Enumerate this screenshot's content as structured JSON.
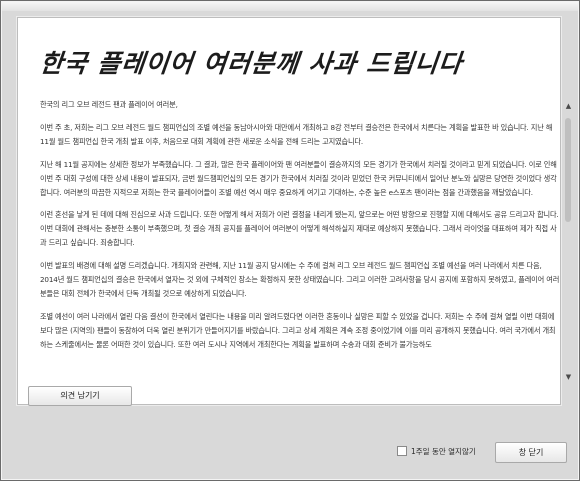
{
  "dialog": {
    "title": "한국 플레이어 여러분께 사과 드립니다",
    "greeting": "한국의 리그 오브 레전드 팬과 플레이어 여러분,",
    "paragraphs": [
      "이번 주 초, 저희는 리그 오브 레전드 월드 챔피언십의 조별 예선을 동남아시아와 대만에서 개최하고 8강 전부터 결승전은 한국에서 치른다는 계획을 발표한 바 있습니다. 지난 해 11월 월드 챔피언십 한국 개최 발표 이후, 처음으로 대회 계획에 관한 새로운 소식을 전해 드리는 고지였습니다.",
      "지난 해 11월 공지에는 상세한 정보가 부족했습니다. 그 결과, 많은 한국 플레이어와 팬 여러분들이 결승까지의 모든 경기가 한국에서 치러질 것이라고 믿게 되었습니다. 이로 인해 이번 주 대회 구성에 대한 상세 내용이 발표되자, 금번 월드챔피언십의 모든 경기가 한국에서 치러질 것이라 믿었던 한국 커뮤니티에서 일어난 분노와 실망은 당연한 것이었다 생각합니다. 여러분의 따끔한 지적으로 저희는 한국 플레이어들이 조별 예선 역시 매우 중요하게 여기고 기대하는, 수준 높은 e스포츠 팬이라는 점을 간과했음을 깨달았습니다.",
      "이런 혼선을 낳게 된 데에 대해 진심으로 사과 드립니다. 또한 어떻게 해서 저희가 이런 결정을 내리게 됐는지, 앞으로는 어떤 방향으로 진행할 지에 대해서도 공유 드리고자 합니다. 이번 대회에 관해서는 충분한 소통이 부족했으며, 첫 결승 개최 공지를 플레이어 여러분이 어떻게 해석하실지 제대로 예상하지 못했습니다. 그래서 라이엇을 대표하여 제가 직접 사과 드리고 싶습니다. 죄송합니다.",
      "이번 발표의 배경에 대해 설명 드리겠습니다. 개최지와 관련해, 지난 11월 공지 당시에는 수 주에 걸쳐 리그 오브 레전드 월드 챔피언십 조별 예선을 여러 나라에서 치른 다음, 2014년 월드 챔피언십의 결승은 한국에서 열자는 것 외에 구체적인 장소는 확정하지 못한 상태였습니다. 그리고 이러한 고려사항을 당시 공지에 포함하지 못하였고, 플레이어 여러분들은 대회 전체가 한국에서 단독 개최될 것으로 예상하게 되었습니다.",
      "조별 예선이 여러 나라에서 열린 다음 결선이 한국에서 열린다는 내용을 미리 알려드렸다면 이러한 혼동이나 실망은 피할 수 있었을 겁니다. 저희는 수 주에 걸쳐 열릴 이번 대회에 보다 많은 (지역의) 팬들이 동참하여 더욱 열린 분위기가 만들어지기를 바랐습니다. 그리고 상세 계획은 계속 조정 중이었기에 이를 미리 공개하지 못했습니다. 여러 국가에서 개최하는 스케줄에서는 물론 어떠한 것이 있습니다. 또한 여러 도시나 지역에서 개최한다는 계획을 발표하며 수송과 대회 준비가 불가능하도"
    ],
    "feedback_button": "의견 남기기",
    "checkbox_label": "1주일 동안 열지않기",
    "close_button": "창 닫기",
    "scroll_up_glyph": "▲",
    "scroll_down_glyph": "▼"
  }
}
